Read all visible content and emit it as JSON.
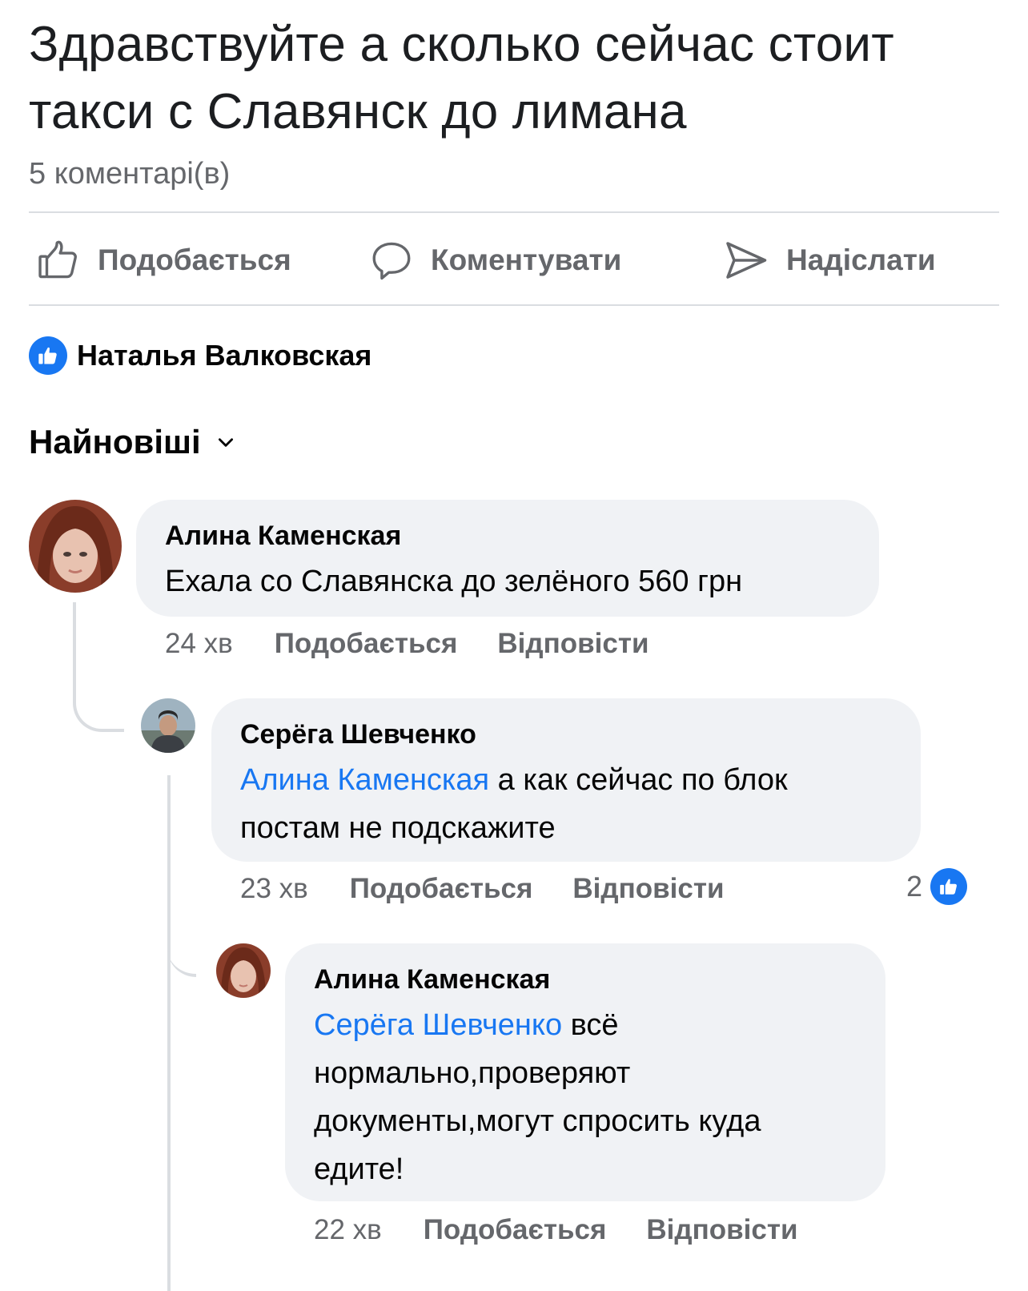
{
  "post": {
    "text_line1": "Здравствуйте а сколько сейчас стоит",
    "text_line2": "такси с Славянск  до лимана",
    "comment_count": "5 коментарі(в)"
  },
  "actions": {
    "like": "Подобається",
    "comment": "Коментувати",
    "send": "Надіслати"
  },
  "reactions": {
    "reactor_name": "Наталья Валковская"
  },
  "sort": {
    "label": "Найновіші"
  },
  "comments": [
    {
      "author": "Алина Каменская",
      "text": "Ехала со Славянска до зелёного 560 грн",
      "time": "24 хв",
      "like": "Подобається",
      "reply": "Відповісти"
    },
    {
      "author": "Серёга Шевченко",
      "mention": "Алина Каменская",
      "text_after_mention": " а как сейчас по блок",
      "text_line2": "постам не подскажите",
      "time": "23 хв",
      "like": "Подобається",
      "reply": "Відповісти",
      "reaction_count": "2"
    },
    {
      "author": "Алина Каменская",
      "mention": "Серёга Шевченко",
      "text_after_mention": " всё",
      "text_line2": "нормально,проверяют",
      "text_line3": "документы,могут спросить куда",
      "text_line4": "едите!",
      "time": "22 хв",
      "like": "Подобається",
      "reply": "Відповісти"
    }
  ],
  "colors": {
    "accent": "#1877f2",
    "secondary_text": "#65676b",
    "bubble": "#f0f2f5"
  },
  "icons": {
    "like": "thumbs-up-icon",
    "comment": "speech-bubble-icon",
    "send": "send-arrow-icon",
    "sort": "chevron-down-icon",
    "reaction": "like-reaction-icon"
  }
}
